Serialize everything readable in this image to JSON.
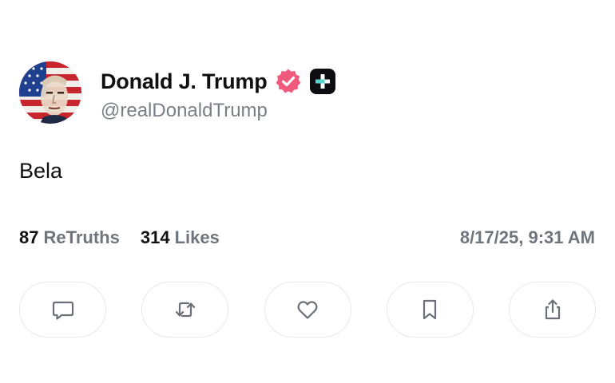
{
  "post": {
    "author": {
      "display_name": "Donald J. Trump",
      "handle": "@realDonaldTrump",
      "avatar_icon": "flag-portrait-avatar",
      "verified_icon": "verified-badge-icon",
      "verified_color": "#ef5a7d",
      "plus_badge_icon": "truth-plus-badge-icon"
    },
    "text": "Bela",
    "stats": {
      "retruths_count": "87",
      "retruths_label": "ReTruths",
      "likes_count": "314",
      "likes_label": "Likes"
    },
    "timestamp": "8/17/25, 9:31 AM",
    "actions": [
      {
        "name": "reply",
        "icon": "comment-icon"
      },
      {
        "name": "retruth",
        "icon": "retruth-icon"
      },
      {
        "name": "like",
        "icon": "heart-icon"
      },
      {
        "name": "bookmark",
        "icon": "bookmark-icon"
      },
      {
        "name": "share",
        "icon": "share-icon"
      }
    ]
  }
}
